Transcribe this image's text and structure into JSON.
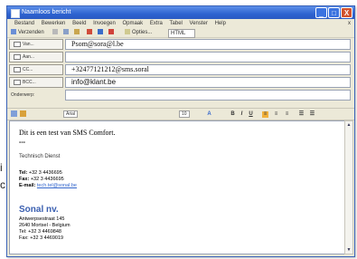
{
  "window": {
    "title": "Naamloos bericht",
    "minimize": "_",
    "maximize": "□",
    "close": "X"
  },
  "menu": {
    "items": [
      "Bestand",
      "Bewerken",
      "Beeld",
      "Invoegen",
      "Opmaak",
      "Extra",
      "Tabel",
      "Venster",
      "Help"
    ],
    "close_doc": "x"
  },
  "toolbar": {
    "send": "Verzenden",
    "options": "Opties...",
    "format": "HTML"
  },
  "headers": {
    "to_label": "Van...",
    "to_value": "Psom@sora@l.be",
    "cc_label": "Aan...",
    "cc_value": "",
    "bcc_label": "CC...",
    "bcc_value": "+32477121212@sms.soral",
    "extra_label": "BCC...",
    "extra_value": "info@klant.be",
    "subject_label": "Onderwerp:",
    "subject_value": ""
  },
  "formatting": {
    "font": "Arial",
    "size": "10"
  },
  "message": {
    "line1": "Dit is een test van SMS Comfort.",
    "separator": "---",
    "dept": "Technisch Dienst",
    "tel_label": "Tel:",
    "tel_value": "+32 3 4436695",
    "fax_label": "Fax:",
    "fax_value": "+32 3 4436695",
    "email_label": "E-mail:",
    "email_value": "tech.tel@sonal.be",
    "company": "Sonal nv.",
    "address1": "Antwerpsestraat 145",
    "address2": "2640 Mortsel - Belgium",
    "tel2": "Tel: +32 3 4469848",
    "fax2": "Fax: +32 3 4469019"
  },
  "outside": {
    "left_char": "i",
    "left_char2": "c"
  },
  "colors": {
    "titlebar": "#2e63d0",
    "company": "#3a5fb0",
    "link": "#3366cc"
  }
}
